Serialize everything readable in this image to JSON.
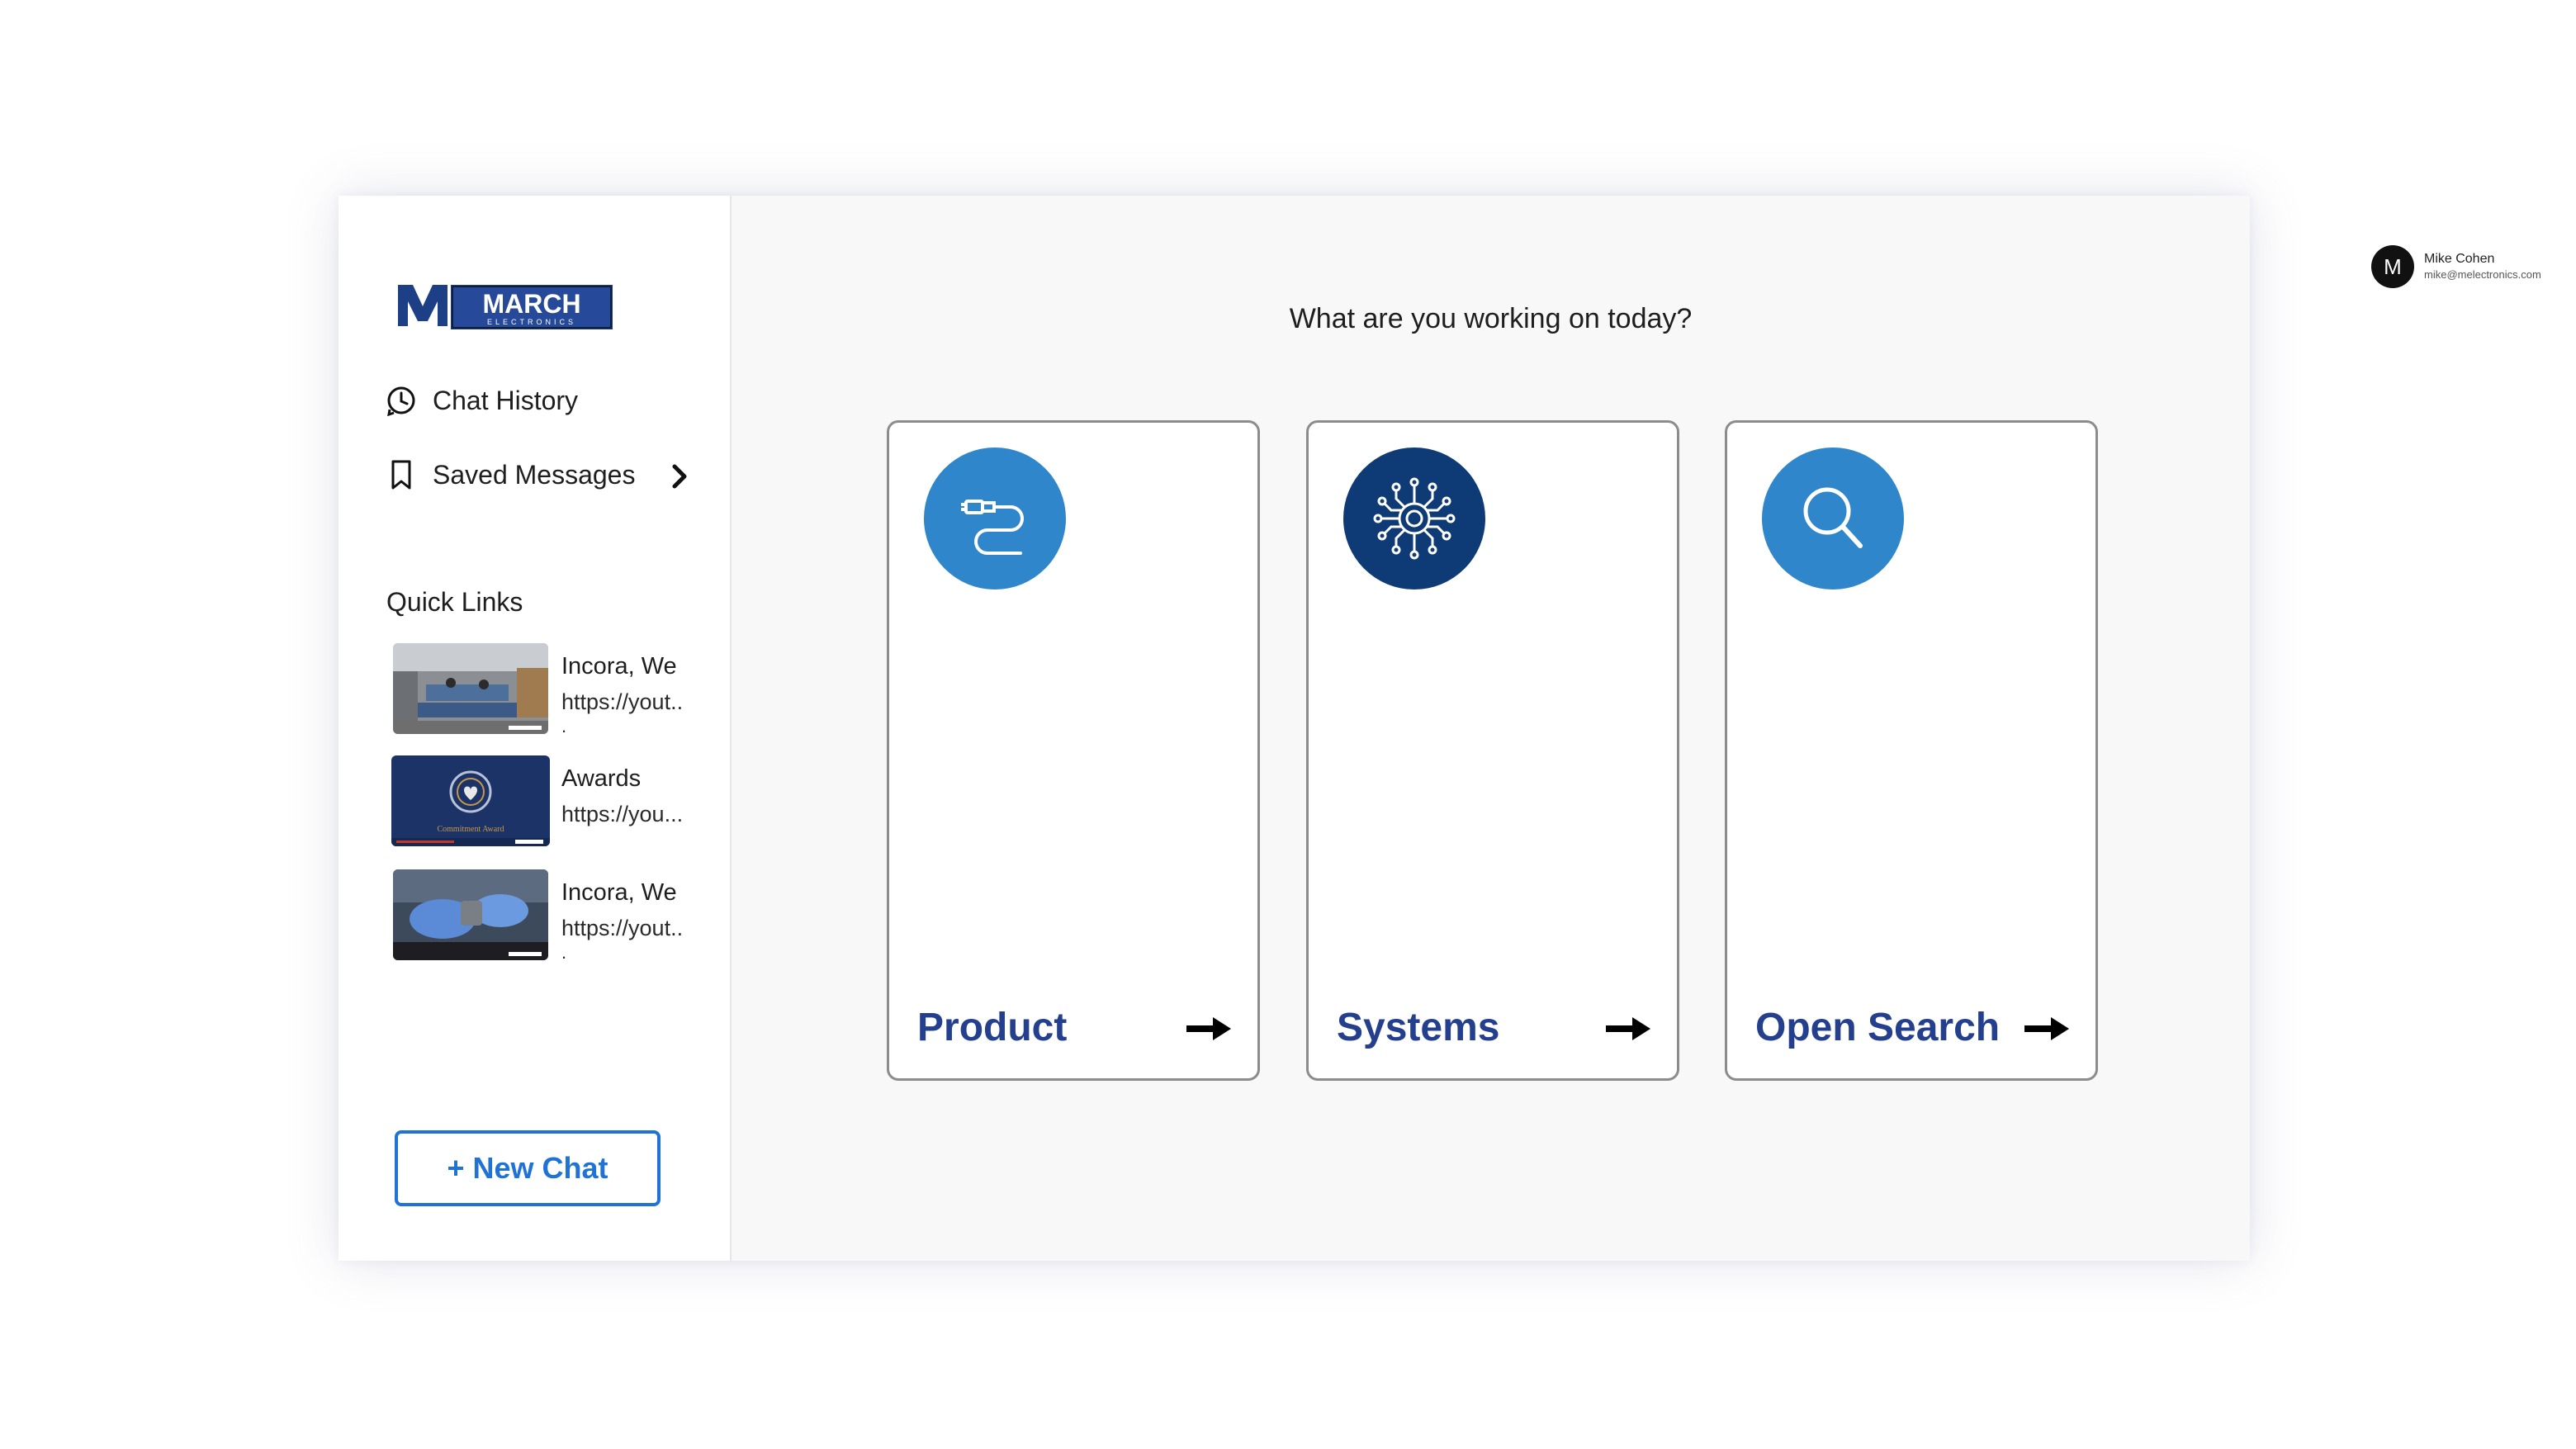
{
  "sidebar": {
    "logo": {
      "main": "MARCH",
      "sub": "ELECTRONICS",
      "icon": "march-logo"
    },
    "nav": {
      "chat_history": "Chat History",
      "saved_messages": "Saved Messages"
    },
    "quick_links_title": "Quick Links",
    "quick_links": [
      {
        "title": "Incora, We",
        "url": "https://yout..",
        "trail": ".",
        "thumb": "factory-floor-thumbnail"
      },
      {
        "title": "Awards",
        "url": "https://you...",
        "trail": "",
        "thumb": "commitment-award-thumbnail",
        "thumb_caption": "Commitment Award"
      },
      {
        "title": "Incora, We",
        "url": "https://yout..",
        "trail": ".",
        "thumb": "gloved-hands-thumbnail"
      }
    ],
    "new_chat_label": "+ New Chat"
  },
  "header": {
    "user": {
      "initial": "M",
      "name": "Mike Cohen",
      "email": "mike@melectronics.com"
    },
    "caret": "▼"
  },
  "main": {
    "headline": "What are you working on today?",
    "cards": [
      {
        "label": "Product",
        "icon": "cable-icon",
        "icon_color": "#2f86cb"
      },
      {
        "label": "Systems",
        "icon": "circuit-chip-icon",
        "icon_color": "#0e3a75"
      },
      {
        "label": "Open Search",
        "icon": "magnifier-icon",
        "icon_color": "#2f86cb"
      }
    ]
  },
  "colors": {
    "accent_blue": "#1f72d6",
    "card_label": "#233f8d",
    "main_bg": "#f8f8f8"
  }
}
